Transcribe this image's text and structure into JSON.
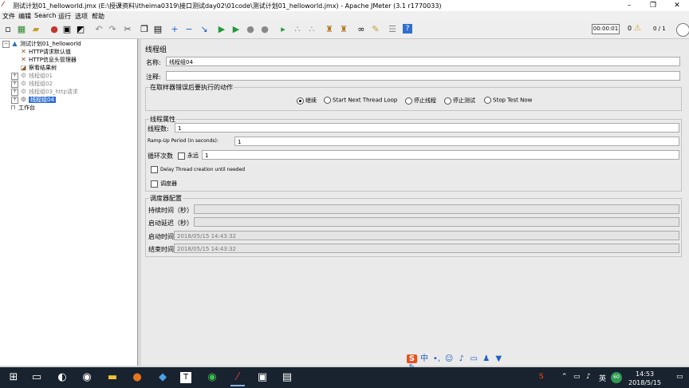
{
  "window": {
    "title": "测试计划01_helloworld.jmx (E:\\授课资料\\itheima0319\\接口测试day02\\01code\\测试计划01_helloworld.jmx) - Apache JMeter (3.1 r1770033)",
    "controls": [
      "–",
      "❐",
      "✕"
    ]
  },
  "menu": [
    "文件",
    "编辑",
    "Search",
    "运行",
    "选项",
    "帮助"
  ],
  "toolbar": {
    "timer": "00:00:01",
    "warning_count": "0",
    "thread_ratio": "0 / 1"
  },
  "tree": {
    "root": "测试计划01_helloworld",
    "children": [
      {
        "label": "HTTP请求默认值",
        "icon": "wrench-icon"
      },
      {
        "label": "HTTP信息头管理器",
        "icon": "wrench-icon"
      },
      {
        "label": "察看结果树",
        "icon": "listener-icon"
      },
      {
        "label": "线程组01",
        "icon": "threadgroup-icon"
      },
      {
        "label": "线程组02",
        "icon": "threadgroup-icon"
      },
      {
        "label": "线程组03_http请求",
        "icon": "threadgroup-icon"
      },
      {
        "label": "线程组04",
        "icon": "threadgroup-icon"
      }
    ],
    "workbench": "工作台"
  },
  "panel": {
    "title": "线程组",
    "name_label": "名称:",
    "name_value": "线程组04",
    "comment_label": "注释:",
    "comment_value": "",
    "on_error": {
      "legend": "在取样器错误后要执行的动作",
      "options": [
        "继续",
        "Start Next Thread Loop",
        "停止线程",
        "停止测试",
        "Stop Test Now"
      ],
      "selected": "继续"
    },
    "thread_props": {
      "legend": "线程属性",
      "threads_label": "线程数:",
      "threads_value": "1",
      "rampup_label": "Ramp-Up Period (in seconds):",
      "rampup_value": "1",
      "loop_label": "循环次数",
      "forever_label": "永远",
      "loop_value": "1",
      "delay_label": "Delay Thread creation until needed",
      "scheduler_label": "调度器"
    },
    "scheduler": {
      "legend": "调度器配置",
      "duration_label": "持续时间（秒）",
      "duration_value": "",
      "startup_delay_label": "启动延迟（秒）",
      "startup_delay_value": "",
      "start_label": "启动时间",
      "start_value": "2018/05/15 14:43:32",
      "end_label": "结束时间",
      "end_value": "2018/05/15 14:43:32"
    }
  },
  "ime": {
    "label": "中"
  },
  "taskbar": {
    "time": "14:53",
    "date": "2018/5/15",
    "badge": "60",
    "tray_lang": "英"
  }
}
